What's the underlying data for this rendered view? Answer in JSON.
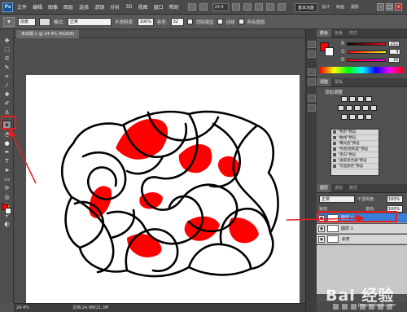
{
  "menubar": {
    "logo": "Ps",
    "items": [
      "文件",
      "编辑",
      "图像",
      "图层",
      "选择",
      "滤镜",
      "分析",
      "3D",
      "视图",
      "窗口",
      "帮助"
    ],
    "zoom": "24.4",
    "workspaces": [
      "基本功能",
      "设计",
      "绘画",
      "摄影"
    ]
  },
  "options": {
    "mode_label": "模式:",
    "mode_value": "正常",
    "opacity_label": "不透明度:",
    "opacity_value": "100%",
    "tolerance_label": "容差:",
    "tolerance_value": "32",
    "antialias_label": "消除锯齿",
    "contiguous_label": "连续",
    "all_layers_label": "所有图层"
  },
  "document": {
    "tab_title": "未标题-1 @ 24.4% (RGB/8)",
    "status_zoom": "24.4%",
    "status_doc": "文档:24.9M/21.3M"
  },
  "color_panel": {
    "tabs": [
      "颜色",
      "色板",
      "样式"
    ],
    "r": "252",
    "g": "4",
    "b": "18"
  },
  "adjustments_panel": {
    "tabs": [
      "调整",
      "蒙版"
    ],
    "title": "添加调整",
    "presets": [
      "\"色阶\"预设",
      "\"曲线\"预设",
      "\"曝光度\"预设",
      "\"色相/饱和度\"预设",
      "\"黑白\"预设",
      "\"通道混合器\"预设",
      "\"可选颜色\"预设"
    ]
  },
  "layers_panel": {
    "tabs": [
      "图层",
      "通道",
      "路径"
    ],
    "blend_mode": "正常",
    "opacity_label": "不透明度:",
    "opacity_value": "100%",
    "lock_label": "锁定:",
    "fill_label": "填充:",
    "fill_value": "100%",
    "layers": [
      {
        "name": "图层 2",
        "selected": true
      },
      {
        "name": "图层 1",
        "selected": false
      },
      {
        "name": "背景",
        "selected": false
      }
    ]
  },
  "watermark": {
    "text": "Bai 经验",
    "sub": "jingyan.baidu.com"
  },
  "colors": {
    "foreground": "#ff0000",
    "background": "#ffffff",
    "highlight": "#e02020",
    "selection": "#3a7edb"
  }
}
